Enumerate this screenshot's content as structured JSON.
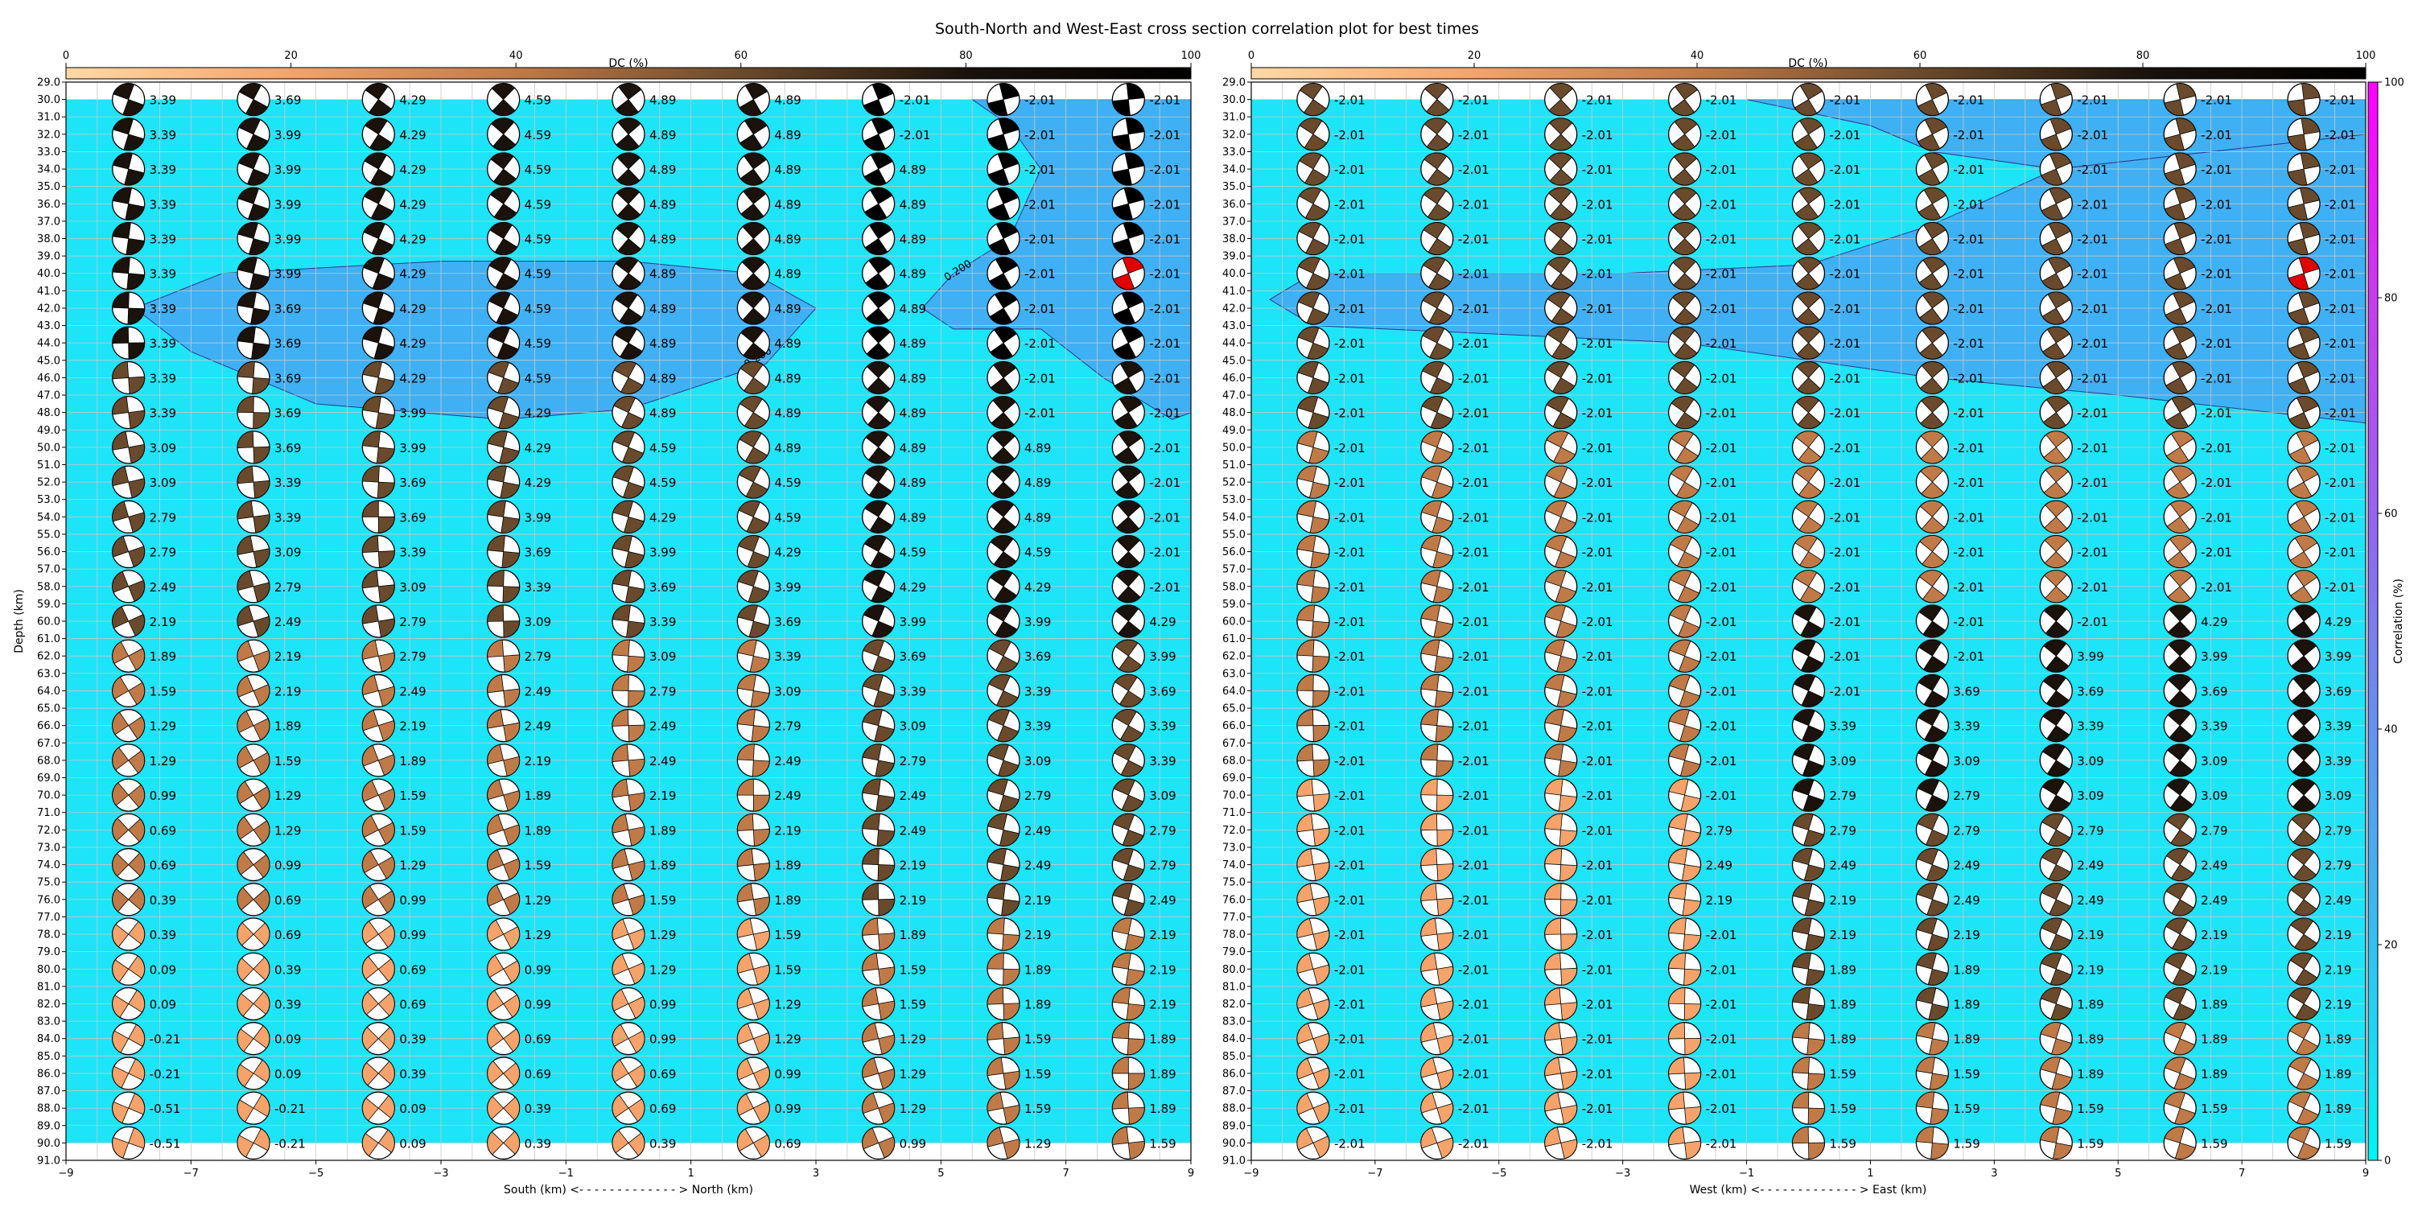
{
  "figure": {
    "title": "South-North and West-East cross section correlation plot for best times"
  },
  "chart_data": [
    {
      "type": "beachball_cross_section",
      "name": "south-north",
      "xlabel": "South (km) <- - - - - - - - - - - - - > North (km)",
      "ylabel": "Depth (km)",
      "xlim": [
        -9,
        9
      ],
      "ylim": [
        91,
        29
      ],
      "xticks": [
        "−9",
        "−7",
        "−5",
        "−3",
        "−1",
        "1",
        "3",
        "5",
        "7",
        "9"
      ],
      "dc_label": "DC (%)",
      "dc_ticks": [
        "0",
        "20",
        "40",
        "60",
        "80",
        "100"
      ],
      "x_positions": [
        -8,
        -6,
        -4,
        -2,
        0,
        2,
        4,
        6,
        8
      ],
      "depths": [
        30,
        32,
        34,
        36,
        38,
        40,
        42,
        44,
        46,
        48,
        50,
        52,
        54,
        56,
        58,
        60,
        62,
        64,
        66,
        68,
        70,
        72,
        74,
        76,
        78,
        80,
        82,
        84,
        86,
        88,
        90
      ],
      "contour_labels": [
        "0.200",
        "0.200"
      ],
      "highlight": {
        "x": 8,
        "depth": 40,
        "color": "#e00000"
      },
      "time_labels": [
        [
          "3.39",
          "3.69",
          "4.29",
          "4.59",
          "4.89",
          "4.89",
          "-2.01",
          "-2.01",
          "-2.01"
        ],
        [
          "3.39",
          "3.99",
          "4.29",
          "4.59",
          "4.89",
          "4.89",
          "-2.01",
          "-2.01",
          "-2.01"
        ],
        [
          "3.39",
          "3.99",
          "4.29",
          "4.59",
          "4.89",
          "4.89",
          "4.89",
          "-2.01",
          "-2.01"
        ],
        [
          "3.39",
          "3.99",
          "4.29",
          "4.59",
          "4.89",
          "4.89",
          "4.89",
          "-2.01",
          "-2.01"
        ],
        [
          "3.39",
          "3.99",
          "4.29",
          "4.59",
          "4.89",
          "4.89",
          "4.89",
          "-2.01",
          "-2.01"
        ],
        [
          "3.39",
          "3.99",
          "4.29",
          "4.59",
          "4.89",
          "4.89",
          "4.89",
          "-2.01",
          "-2.01"
        ],
        [
          "3.39",
          "3.69",
          "4.29",
          "4.59",
          "4.89",
          "4.89",
          "4.89",
          "-2.01",
          "-2.01"
        ],
        [
          "3.39",
          "3.69",
          "4.29",
          "4.59",
          "4.89",
          "4.89",
          "4.89",
          "-2.01",
          "-2.01"
        ],
        [
          "3.39",
          "3.69",
          "4.29",
          "4.59",
          "4.89",
          "4.89",
          "4.89",
          "-2.01",
          "-2.01"
        ],
        [
          "3.39",
          "3.69",
          "3.99",
          "4.29",
          "4.89",
          "4.89",
          "4.89",
          "-2.01",
          "-2.01"
        ],
        [
          "3.09",
          "3.69",
          "3.99",
          "4.29",
          "4.59",
          "4.89",
          "4.89",
          "4.89",
          "-2.01"
        ],
        [
          "3.09",
          "3.39",
          "3.69",
          "4.29",
          "4.59",
          "4.59",
          "4.89",
          "4.89",
          "-2.01"
        ],
        [
          "2.79",
          "3.39",
          "3.69",
          "3.99",
          "4.29",
          "4.59",
          "4.89",
          "4.89",
          "-2.01"
        ],
        [
          "2.79",
          "3.09",
          "3.39",
          "3.69",
          "3.99",
          "4.29",
          "4.59",
          "4.59",
          "-2.01"
        ],
        [
          "2.49",
          "2.79",
          "3.09",
          "3.39",
          "3.69",
          "3.99",
          "4.29",
          "4.29",
          "-2.01"
        ],
        [
          "2.19",
          "2.49",
          "2.79",
          "3.09",
          "3.39",
          "3.69",
          "3.99",
          "3.99",
          "4.29"
        ],
        [
          "1.89",
          "2.19",
          "2.79",
          "2.79",
          "3.09",
          "3.39",
          "3.69",
          "3.69",
          "3.99"
        ],
        [
          "1.59",
          "2.19",
          "2.49",
          "2.49",
          "2.79",
          "3.09",
          "3.39",
          "3.39",
          "3.69"
        ],
        [
          "1.29",
          "1.89",
          "2.19",
          "2.49",
          "2.49",
          "2.79",
          "3.09",
          "3.39",
          "3.39"
        ],
        [
          "1.29",
          "1.59",
          "1.89",
          "2.19",
          "2.49",
          "2.49",
          "2.79",
          "3.09",
          "3.39"
        ],
        [
          "0.99",
          "1.29",
          "1.59",
          "1.89",
          "2.19",
          "2.49",
          "2.49",
          "2.79",
          "3.09"
        ],
        [
          "0.69",
          "1.29",
          "1.59",
          "1.89",
          "1.89",
          "2.19",
          "2.49",
          "2.49",
          "2.79"
        ],
        [
          "0.69",
          "0.99",
          "1.29",
          "1.59",
          "1.89",
          "1.89",
          "2.19",
          "2.49",
          "2.79"
        ],
        [
          "0.39",
          "0.69",
          "0.99",
          "1.29",
          "1.59",
          "1.89",
          "2.19",
          "2.19",
          "2.49"
        ],
        [
          "0.39",
          "0.69",
          "0.99",
          "1.29",
          "1.29",
          "1.59",
          "1.89",
          "2.19",
          "2.19"
        ],
        [
          "0.09",
          "0.39",
          "0.69",
          "0.99",
          "1.29",
          "1.59",
          "1.59",
          "1.89",
          "2.19"
        ],
        [
          "0.09",
          "0.39",
          "0.69",
          "0.99",
          "0.99",
          "1.29",
          "1.59",
          "1.89",
          "2.19"
        ],
        [
          "-0.21",
          "0.09",
          "0.39",
          "0.69",
          "0.99",
          "1.29",
          "1.29",
          "1.59",
          "1.89"
        ],
        [
          "-0.21",
          "0.09",
          "0.39",
          "0.69",
          "0.69",
          "0.99",
          "1.29",
          "1.59",
          "1.89"
        ],
        [
          "-0.51",
          "-0.21",
          "0.09",
          "0.39",
          "0.69",
          "0.99",
          "1.29",
          "1.59",
          "1.89"
        ],
        [
          "-0.51",
          "-0.21",
          "0.09",
          "0.39",
          "0.39",
          "0.69",
          "0.99",
          "1.29",
          "1.59"
        ]
      ]
    },
    {
      "type": "beachball_cross_section",
      "name": "west-east",
      "xlabel": "West (km) <- - - - - - - - - - - - - > East (km)",
      "ylabel": "",
      "xlim": [
        -9,
        9
      ],
      "ylim": [
        91,
        29
      ],
      "xticks": [
        "−9",
        "−7",
        "−5",
        "−3",
        "−1",
        "1",
        "3",
        "5",
        "7",
        "9"
      ],
      "dc_label": "DC (%)",
      "dc_ticks": [
        "0",
        "20",
        "40",
        "60",
        "80",
        "100"
      ],
      "x_positions": [
        -8,
        -6,
        -4,
        -2,
        0,
        2,
        4,
        6,
        8
      ],
      "depths": [
        30,
        32,
        34,
        36,
        38,
        40,
        42,
        44,
        46,
        48,
        50,
        52,
        54,
        56,
        58,
        60,
        62,
        64,
        66,
        68,
        70,
        72,
        74,
        76,
        78,
        80,
        82,
        84,
        86,
        88,
        90
      ],
      "highlight": {
        "x": 8,
        "depth": 40,
        "color": "#e00000"
      },
      "time_labels": [
        [
          "-2.01",
          "-2.01",
          "-2.01",
          "-2.01",
          "-2.01",
          "-2.01",
          "-2.01",
          "-2.01",
          "-2.01"
        ],
        [
          "-2.01",
          "-2.01",
          "-2.01",
          "-2.01",
          "-2.01",
          "-2.01",
          "-2.01",
          "-2.01",
          "-2.01"
        ],
        [
          "-2.01",
          "-2.01",
          "-2.01",
          "-2.01",
          "-2.01",
          "-2.01",
          "-2.01",
          "-2.01",
          "-2.01"
        ],
        [
          "-2.01",
          "-2.01",
          "-2.01",
          "-2.01",
          "-2.01",
          "-2.01",
          "-2.01",
          "-2.01",
          "-2.01"
        ],
        [
          "-2.01",
          "-2.01",
          "-2.01",
          "-2.01",
          "-2.01",
          "-2.01",
          "-2.01",
          "-2.01",
          "-2.01"
        ],
        [
          "-2.01",
          "-2.01",
          "-2.01",
          "-2.01",
          "-2.01",
          "-2.01",
          "-2.01",
          "-2.01",
          "-2.01"
        ],
        [
          "-2.01",
          "-2.01",
          "-2.01",
          "-2.01",
          "-2.01",
          "-2.01",
          "-2.01",
          "-2.01",
          "-2.01"
        ],
        [
          "-2.01",
          "-2.01",
          "-2.01",
          "-2.01",
          "-2.01",
          "-2.01",
          "-2.01",
          "-2.01",
          "-2.01"
        ],
        [
          "-2.01",
          "-2.01",
          "-2.01",
          "-2.01",
          "-2.01",
          "-2.01",
          "-2.01",
          "-2.01",
          "-2.01"
        ],
        [
          "-2.01",
          "-2.01",
          "-2.01",
          "-2.01",
          "-2.01",
          "-2.01",
          "-2.01",
          "-2.01",
          "-2.01"
        ],
        [
          "-2.01",
          "-2.01",
          "-2.01",
          "-2.01",
          "-2.01",
          "-2.01",
          "-2.01",
          "-2.01",
          "-2.01"
        ],
        [
          "-2.01",
          "-2.01",
          "-2.01",
          "-2.01",
          "-2.01",
          "-2.01",
          "-2.01",
          "-2.01",
          "-2.01"
        ],
        [
          "-2.01",
          "-2.01",
          "-2.01",
          "-2.01",
          "-2.01",
          "-2.01",
          "-2.01",
          "-2.01",
          "-2.01"
        ],
        [
          "-2.01",
          "-2.01",
          "-2.01",
          "-2.01",
          "-2.01",
          "-2.01",
          "-2.01",
          "-2.01",
          "-2.01"
        ],
        [
          "-2.01",
          "-2.01",
          "-2.01",
          "-2.01",
          "-2.01",
          "-2.01",
          "-2.01",
          "-2.01",
          "-2.01"
        ],
        [
          "-2.01",
          "-2.01",
          "-2.01",
          "-2.01",
          "-2.01",
          "-2.01",
          "-2.01",
          "4.29",
          "4.29"
        ],
        [
          "-2.01",
          "-2.01",
          "-2.01",
          "-2.01",
          "-2.01",
          "-2.01",
          "3.99",
          "3.99",
          "3.99"
        ],
        [
          "-2.01",
          "-2.01",
          "-2.01",
          "-2.01",
          "-2.01",
          "3.69",
          "3.69",
          "3.69",
          "3.69"
        ],
        [
          "-2.01",
          "-2.01",
          "-2.01",
          "-2.01",
          "3.39",
          "3.39",
          "3.39",
          "3.39",
          "3.39"
        ],
        [
          "-2.01",
          "-2.01",
          "-2.01",
          "-2.01",
          "3.09",
          "3.09",
          "3.09",
          "3.09",
          "3.39"
        ],
        [
          "-2.01",
          "-2.01",
          "-2.01",
          "-2.01",
          "2.79",
          "2.79",
          "3.09",
          "3.09",
          "3.09"
        ],
        [
          "-2.01",
          "-2.01",
          "-2.01",
          "2.79",
          "2.79",
          "2.79",
          "2.79",
          "2.79",
          "2.79"
        ],
        [
          "-2.01",
          "-2.01",
          "-2.01",
          "2.49",
          "2.49",
          "2.49",
          "2.49",
          "2.49",
          "2.79"
        ],
        [
          "-2.01",
          "-2.01",
          "-2.01",
          "2.19",
          "2.19",
          "2.49",
          "2.49",
          "2.49",
          "2.49"
        ],
        [
          "-2.01",
          "-2.01",
          "-2.01",
          "-2.01",
          "2.19",
          "2.19",
          "2.19",
          "2.19",
          "2.19"
        ],
        [
          "-2.01",
          "-2.01",
          "-2.01",
          "-2.01",
          "1.89",
          "1.89",
          "2.19",
          "2.19",
          "2.19"
        ],
        [
          "-2.01",
          "-2.01",
          "-2.01",
          "-2.01",
          "1.89",
          "1.89",
          "1.89",
          "1.89",
          "2.19"
        ],
        [
          "-2.01",
          "-2.01",
          "-2.01",
          "-2.01",
          "1.89",
          "1.89",
          "1.89",
          "1.89",
          "1.89"
        ],
        [
          "-2.01",
          "-2.01",
          "-2.01",
          "-2.01",
          "1.59",
          "1.59",
          "1.89",
          "1.89",
          "1.89"
        ],
        [
          "-2.01",
          "-2.01",
          "-2.01",
          "-2.01",
          "1.59",
          "1.59",
          "1.59",
          "1.59",
          "1.89"
        ],
        [
          "-2.01",
          "-2.01",
          "-2.01",
          "-2.01",
          "1.59",
          "1.59",
          "1.59",
          "1.59",
          "1.59"
        ]
      ]
    }
  ],
  "correlation_colorbar": {
    "label": "Correlation (%)",
    "range": [
      0,
      100
    ],
    "ticks": [
      "0",
      "20",
      "40",
      "60",
      "80",
      "100"
    ]
  },
  "colors": {
    "background_fill": "#1ee4f8",
    "high_correlation_fill": "#3fb0f4",
    "grid": "#c8c8c8",
    "highlight": "#e00000",
    "dc_colormap": [
      "#ffd9a6",
      "#f5a36a",
      "#c07a48",
      "#6a4a2c",
      "#1a120b",
      "#000000"
    ],
    "correlation_colormap": [
      "#00f5f5",
      "#40b4f0",
      "#8a6ff0",
      "#c83cf0",
      "#ff00ff"
    ]
  }
}
